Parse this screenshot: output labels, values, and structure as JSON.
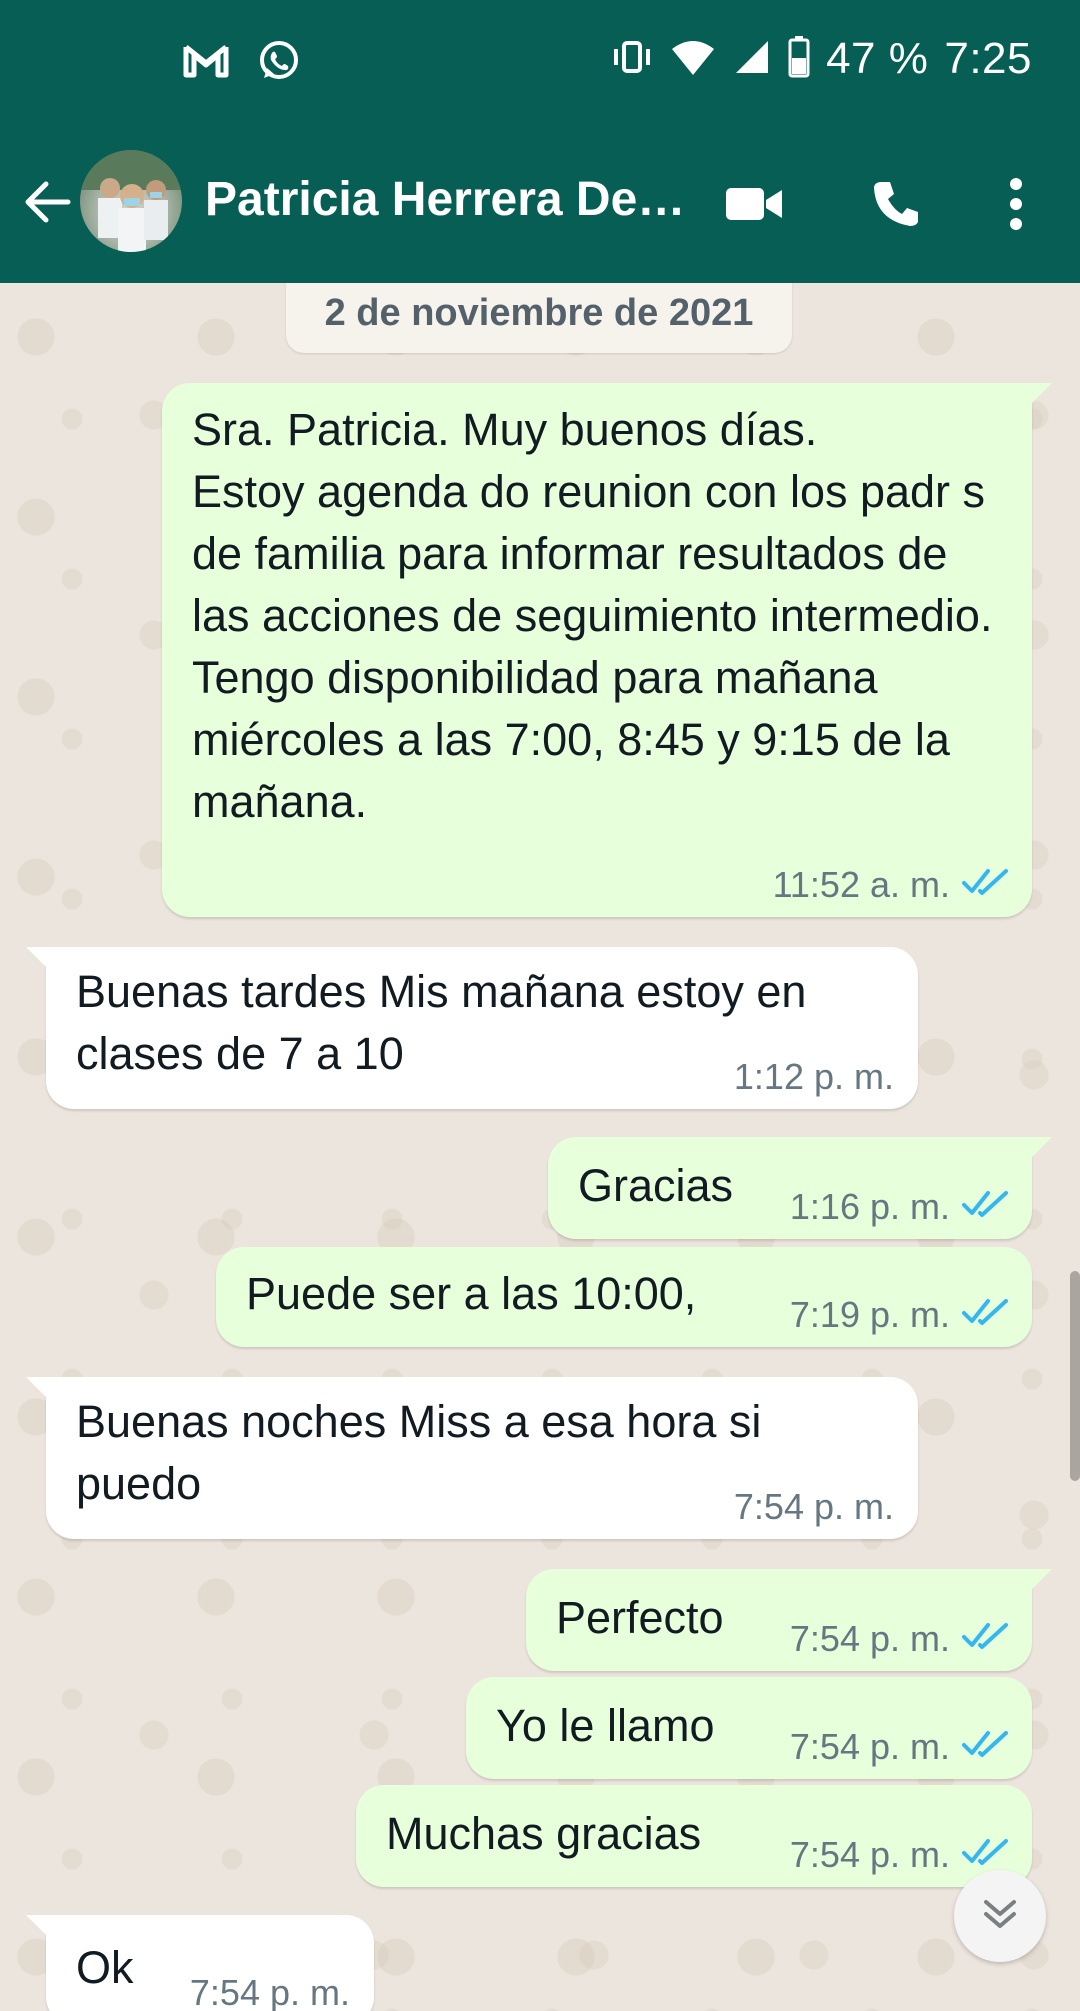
{
  "status_bar": {
    "battery": "47 %",
    "time": "7:25",
    "icons": [
      "gmail-icon",
      "whatsapp-icon",
      "vibrate-icon",
      "wifi-icon",
      "signal-icon",
      "battery-icon"
    ]
  },
  "header": {
    "contact_name": "Patricia Herrera De…",
    "icons": [
      "back-arrow-icon",
      "avatar",
      "video-call-icon",
      "phone-icon",
      "more-vertical-icon"
    ]
  },
  "chat": {
    "date": "2 de noviembre de 2021",
    "messages": [
      {
        "dir": "out",
        "text": "Sra. Patricia. Muy buenos días.\nEstoy agenda do reunion con los padr s de familia para informar resultados de las acciones de seguimiento intermedio.\nTengo disponibilidad para mañana miércoles a las 7:00, 8:45 y 9:15 de la mañana.",
        "time": "11:52 a. m.",
        "read": true
      },
      {
        "dir": "in",
        "text": "Buenas tardes Mis mañana estoy en clases de 7 a 10",
        "time": "1:12 p. m."
      },
      {
        "dir": "out",
        "text": "Gracias",
        "time": "1:16 p. m.",
        "read": true
      },
      {
        "dir": "out",
        "text": "Puede ser a las 10:00,",
        "time": "7:19 p. m.",
        "read": true
      },
      {
        "dir": "in",
        "text": "Buenas noches Miss a esa hora si puedo",
        "time": "7:54 p. m."
      },
      {
        "dir": "out",
        "text": "Perfecto",
        "time": "7:54 p. m.",
        "read": true
      },
      {
        "dir": "out",
        "text": "Yo le llamo",
        "time": "7:54 p. m.",
        "read": true
      },
      {
        "dir": "out",
        "text": "Muchas gracias",
        "time": "7:54 p. m.",
        "read": true
      },
      {
        "dir": "in",
        "text": "Ok",
        "time": "7:54 p. m."
      }
    ]
  },
  "colors": {
    "header": "#075e54",
    "outgoing_bubble": "#e7ffdb",
    "incoming_bubble": "#ffffff",
    "read_ticks": "#34b7f1",
    "chat_background": "#ece5dd"
  }
}
